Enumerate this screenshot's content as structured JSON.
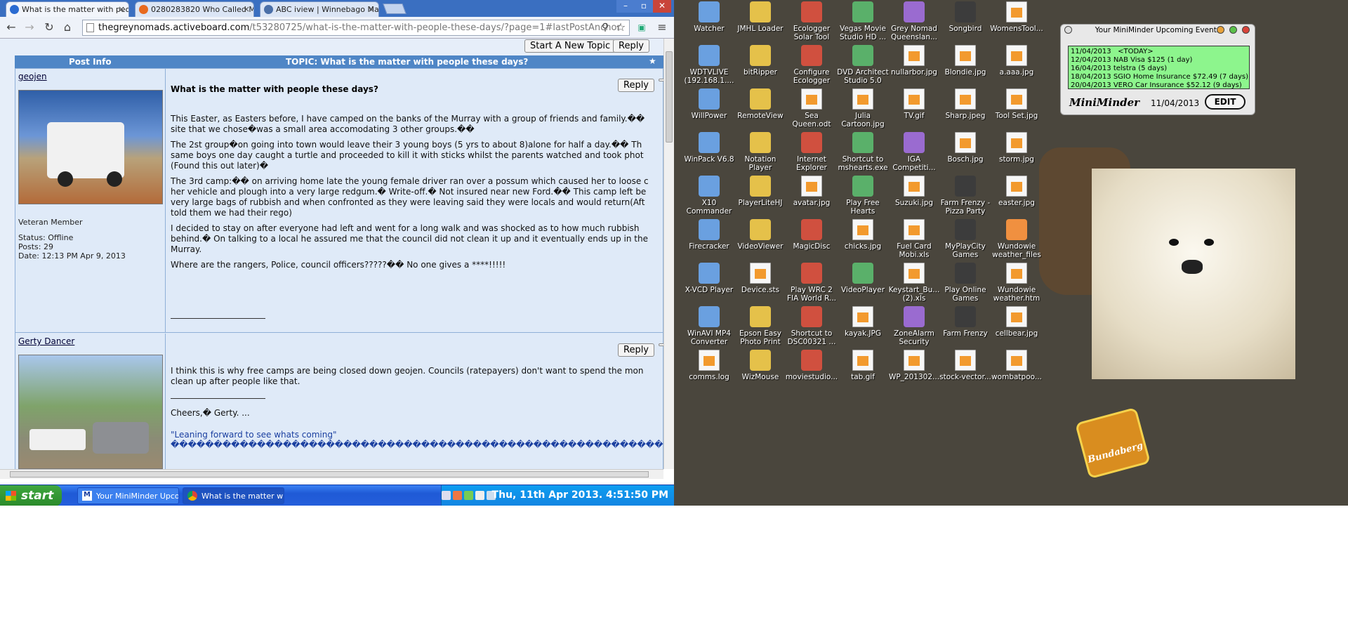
{
  "browser": {
    "tabs": [
      {
        "label": "What is the matter with peop",
        "color": "#2a6bd1"
      },
      {
        "label": "0280283820 Who Called Me",
        "color": "#e86a1f"
      },
      {
        "label": "ABC iview | Winnebago Man",
        "color": "#4a6fa8"
      }
    ],
    "url_host": "thegreynomads.activeboard.com",
    "url_path": "/t53280725/what-is-the-matter-with-people-these-days/?page=1#lastPostAnchor"
  },
  "forum": {
    "start_topic_label": "Start A New Topic",
    "reply_label": "Reply",
    "header_left": "Post Info",
    "header_right": "TOPIC: What is the matter with people these days?",
    "posts": [
      {
        "user": "geojen",
        "rank": "Veteran Member",
        "meta": "Status: Offline\nPosts: 29\nDate: 12:13 PM Apr 9, 2013",
        "title": "What is the matter with people these days?",
        "lines": [
          "This Easter, as Easters before, I have camped on the banks of the Murray with a group of friends and family.��",
          "site that we chose�was a small area accomodating 3 other groups.��",
          "",
          "The 2st group�on going into town would leave their 3 young boys (5 yrs to about 8)alone for half a day.�� Th",
          "same boys one day caught a turtle and proceeded to kill it with sticks whilst the parents watched and took phot",
          "(Found this out later)�",
          "",
          "The 3rd camp:�� on arriving home late the young female driver ran over a possum which caused her to loose c",
          "her vehicle and plough into a very large redgum.� Write-off.� Not insured near new Ford.�� This camp left be",
          "very large bags of rubbish and when confronted as they were leaving said they were locals and would return(Aft",
          "told them we had their rego)",
          "",
          "I decided to stay on after everyone had left and went for a long walk and was shocked as to how much rubbish",
          "behind.� On talking to a local he assured me that the council did not clean it up and it eventually ends up in the",
          "Murray.",
          "",
          "Where are the rangers, Police, council officers?????�� No one gives a ****!!!!!"
        ]
      },
      {
        "user": "Gerty Dancer",
        "lines": [
          "I think this is why free camps are being closed down geojen. Councils (ratepayers) don't want to spend the mon",
          "clean up after people like that."
        ],
        "sig1": "Cheers,� Gerty. ...",
        "sig2": "\"Leaning forward to see whats coming\"",
        "sig3": "������������������������������������������������������������������"
      }
    ]
  },
  "taskbar": {
    "start_label": "start",
    "items": [
      {
        "label": "Your MiniMinder Upco..."
      },
      {
        "label": "What is the matter wi..."
      }
    ],
    "clock": "Thu, 11th Apr 2013. 4:51:50 PM"
  },
  "desktop": {
    "icons": [
      [
        "Watcher",
        "JMHL Loader",
        "Ecologger Solar Tool",
        "Vegas Movie Studio HD ...",
        "Grey Nomad Queenslan...",
        "Songbird",
        "WomensTool..."
      ],
      [
        "WDTVLIVE (192.168.1....",
        "bitRipper",
        "Configure Ecologger",
        "DVD Architect Studio 5.0",
        "nullarbor.jpg",
        "Blondie.jpg",
        "a.aaa.jpg"
      ],
      [
        "WillPower",
        "RemoteView",
        "Sea Queen.odt",
        "Julia Cartoon.jpg",
        "TV.gif",
        "Sharp.jpeg",
        "Tool Set.jpg"
      ],
      [
        "WinPack V6.8",
        "Notation Player",
        "Internet Explorer",
        "Shortcut to mshearts.exe",
        "IGA Competiti...",
        "Bosch.jpg",
        "storm.jpg"
      ],
      [
        "X10 Commander",
        "PlayerLiteHJ",
        "avatar.jpg",
        "Play Free Hearts",
        "Suzuki.jpg",
        "Farm Frenzy - Pizza Party",
        "easter.jpg"
      ],
      [
        "Firecracker",
        "VideoViewer",
        "MagicDisc",
        "chicks.jpg",
        "Fuel Card Mobi.xls",
        "MyPlayCity Games",
        "Wundowie weather_files"
      ],
      [
        "X-VCD Player",
        "Device.sts",
        "Play WRC 2 FIA World R...",
        "VideoPlayer",
        "Keystart_Bu... (2).xls",
        "Play Online Games",
        "Wundowie weather.htm"
      ],
      [
        "WinAVI MP4 Converter",
        "Epson Easy Photo Print",
        "Shortcut to DSC00321 ...",
        "kayak.JPG",
        "ZoneAlarm Security",
        "Farm Frenzy",
        "cellbear.jpg"
      ],
      [
        "comms.log",
        "WizMouse",
        "moviestudio...",
        "tab.gif",
        "WP_201302...",
        "stock-vector...",
        "wombatpoo..."
      ]
    ]
  },
  "miniminder": {
    "title": "Your MiniMinder Upcoming Events",
    "events": "11/04/2013   <TODAY>\n12/04/2013 NAB Visa $125 (1 day)\n16/04/2013 telstra (5 days)\n18/04/2013 SGIO Home Insurance $72.49 (7 days)\n20/04/2013 VERO Car Insurance $52.12 (9 days)",
    "brand": "MiniMinder",
    "date": "11/04/2013",
    "edit_label": "EDIT"
  },
  "wallpaper": {
    "logo_text": "Bundaberg"
  }
}
